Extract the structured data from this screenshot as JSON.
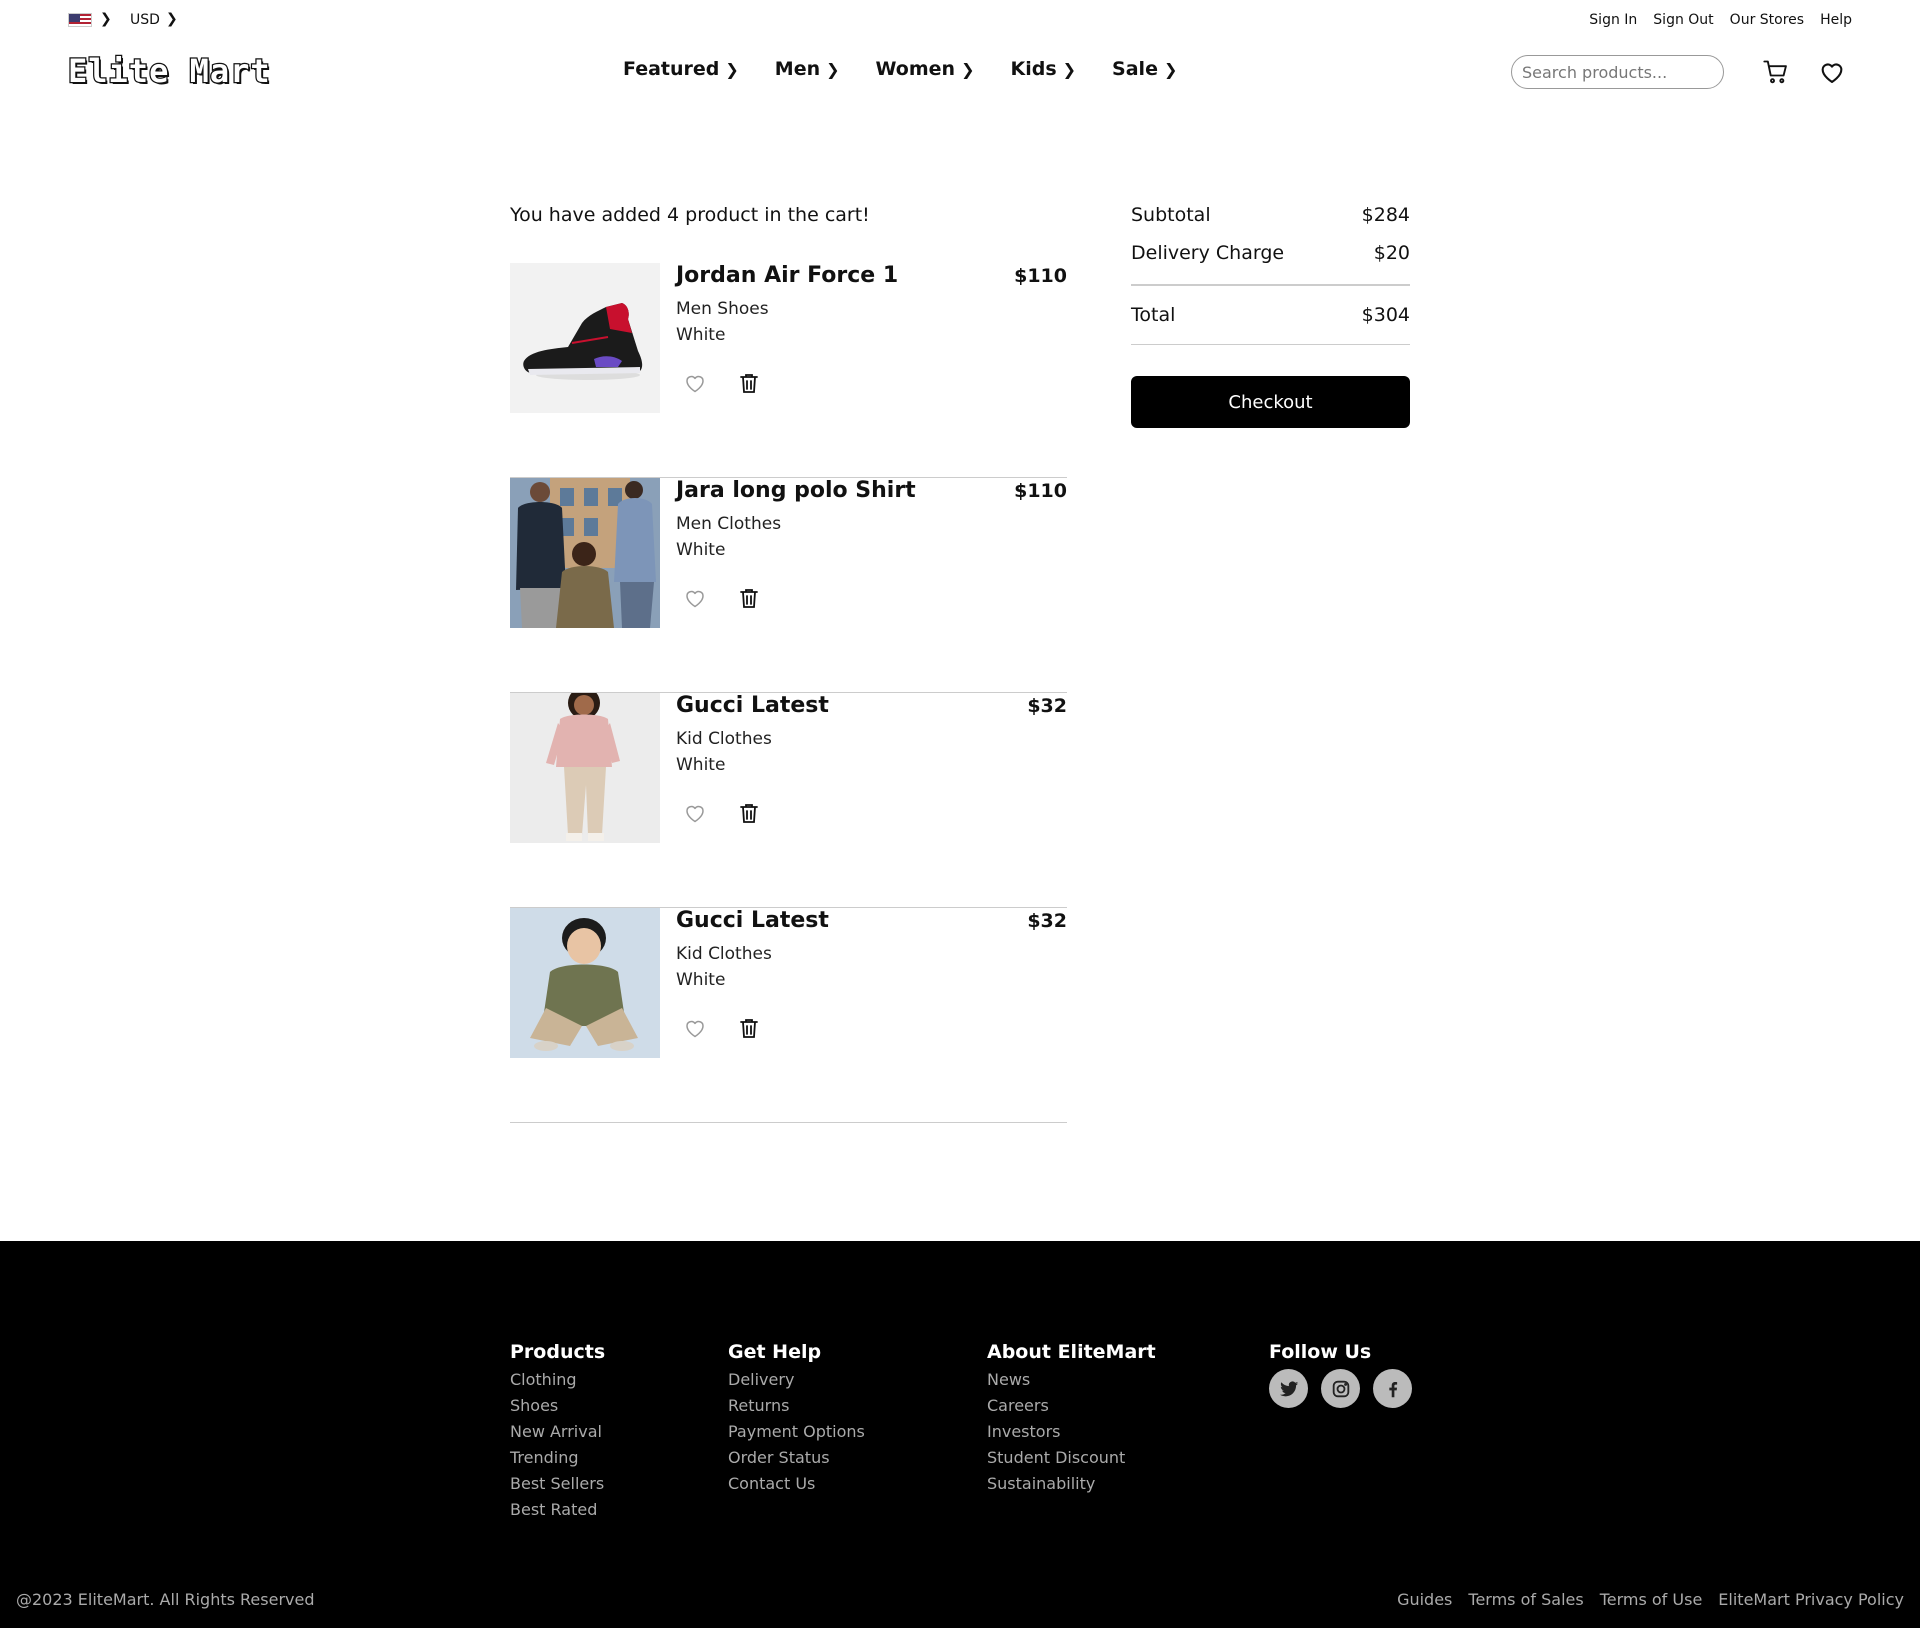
{
  "topbar": {
    "flag_icon": "us-flag-icon",
    "currency": "USD",
    "links": [
      "Sign In",
      "Sign Out",
      "Our Stores",
      "Help"
    ]
  },
  "header": {
    "logo": "Elite Mart",
    "nav": [
      "Featured",
      "Men",
      "Women",
      "Kids",
      "Sale"
    ],
    "search_placeholder": "Search products...",
    "icons": [
      "cart-icon",
      "heart-icon"
    ]
  },
  "cart": {
    "heading": "You have added 4 product in the cart!",
    "items": [
      {
        "name": "Jordan Air Force 1",
        "price": "$110",
        "category": "Men Shoes",
        "color": "White",
        "image": "sneaker-image"
      },
      {
        "name": "Jara long polo Shirt",
        "price": "$110",
        "category": "Men Clothes",
        "color": "White",
        "image": "street-group-photo"
      },
      {
        "name": "Gucci Latest",
        "price": "$32",
        "category": "Kid Clothes",
        "color": "White",
        "image": "girl-pink-sweater-photo"
      },
      {
        "name": "Gucci Latest",
        "price": "$32",
        "category": "Kid Clothes",
        "color": "White",
        "image": "boy-green-sweater-photo"
      }
    ]
  },
  "summary": {
    "subtotal_label": "Subtotal",
    "subtotal": "$284",
    "delivery_label": "Delivery Charge",
    "delivery": "$20",
    "total_label": "Total",
    "total": "$304",
    "checkout": "Checkout"
  },
  "footer": {
    "columns": [
      {
        "title": "Products",
        "links": [
          "Clothing",
          "Shoes",
          "New Arrival",
          "Trending",
          "Best Sellers",
          "Best Rated"
        ]
      },
      {
        "title": "Get Help",
        "links": [
          "Delivery",
          "Returns",
          "Payment Options",
          "Order Status",
          "Contact Us"
        ]
      },
      {
        "title": "About EliteMart",
        "links": [
          "News",
          "Careers",
          "Investors",
          "Student Discount",
          "Sustainability"
        ]
      }
    ],
    "follow_title": "Follow Us",
    "social": [
      "twitter-icon",
      "instagram-icon",
      "facebook-icon"
    ],
    "copyright": "@2023 EliteMart. All Rights Reserved",
    "legal": [
      "Guides",
      "Terms of Sales",
      "Terms of Use",
      "EliteMart Privacy Policy"
    ]
  },
  "colors": {
    "background": "#ffffff",
    "text": "#111111",
    "footer": "#000000",
    "footer_link": "#aaaaaa",
    "divider": "#cccccc"
  }
}
